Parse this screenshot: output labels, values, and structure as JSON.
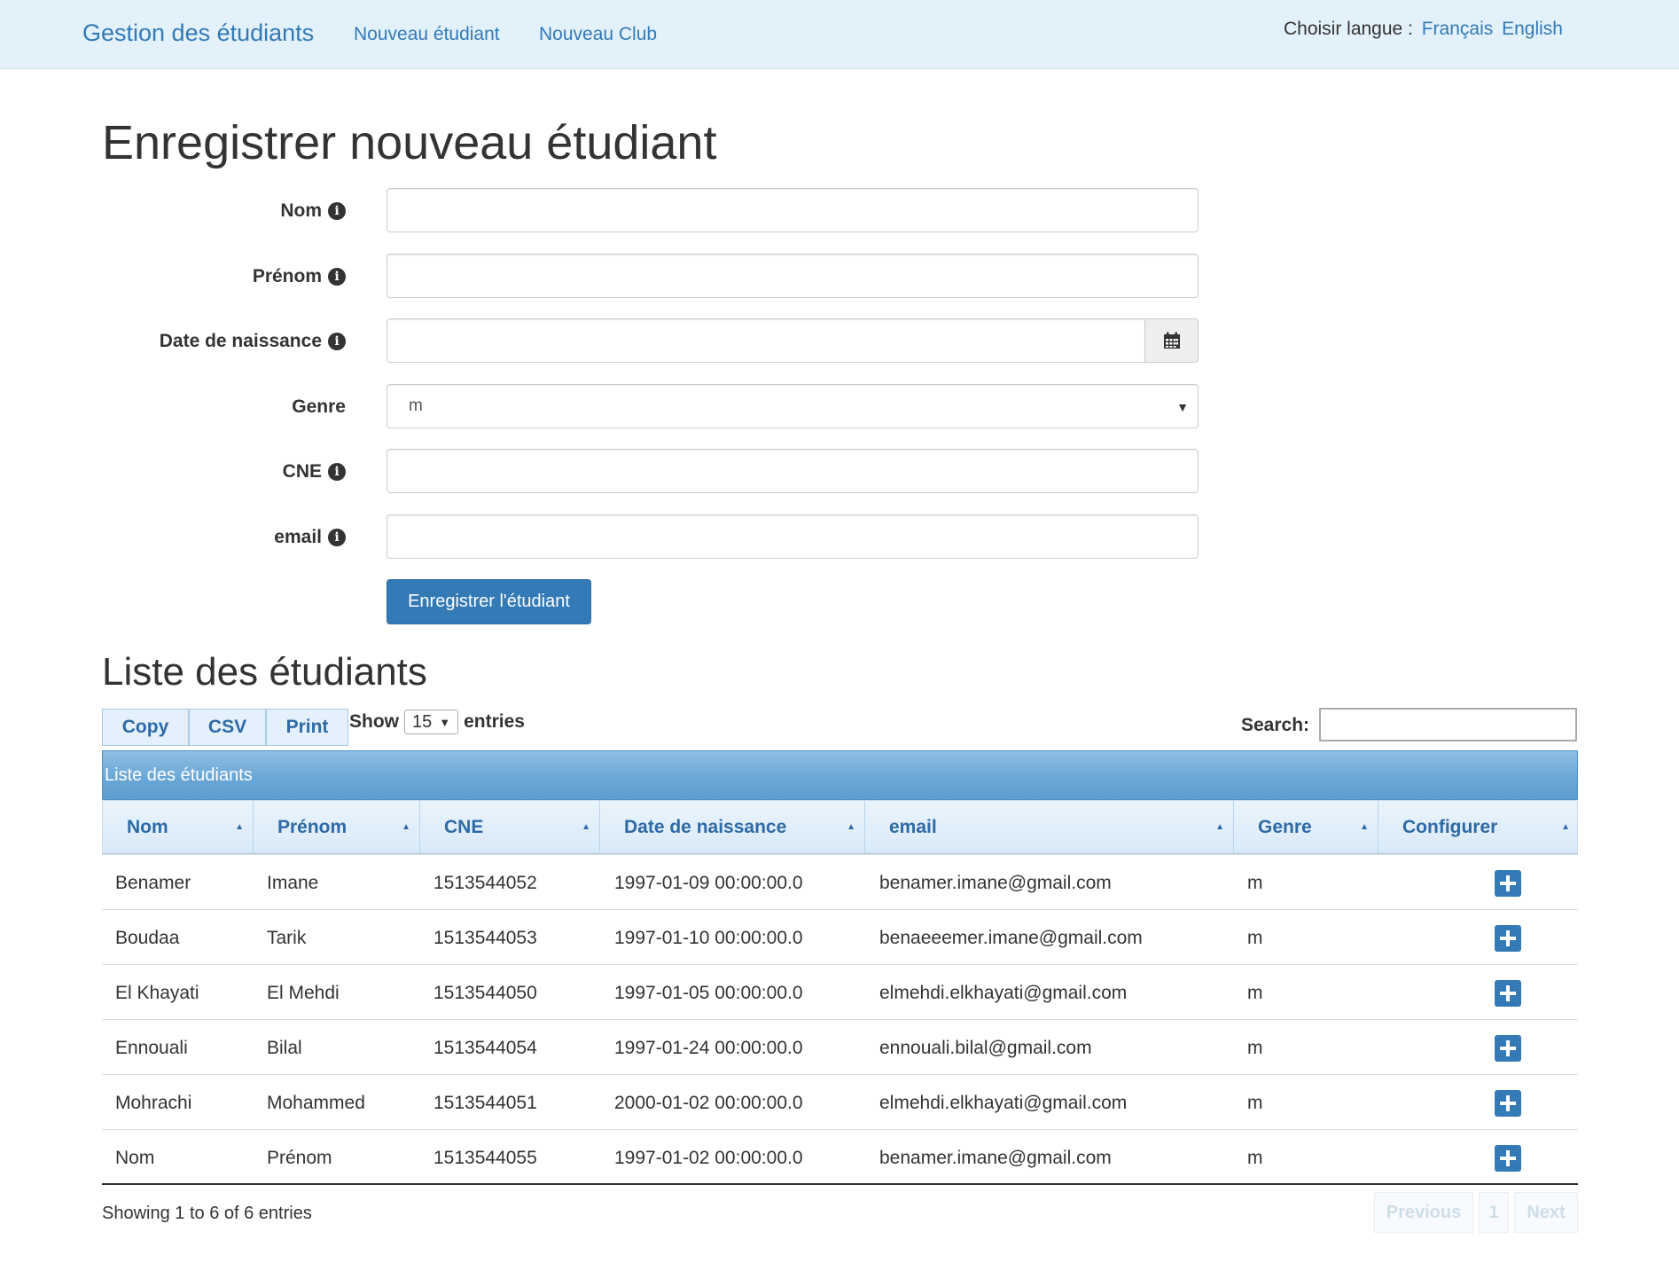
{
  "navbar": {
    "brand": "Gestion des étudiants",
    "links": [
      "Nouveau étudiant",
      "Nouveau Club"
    ],
    "lang_label": "Choisir langue :",
    "lang_fr": "Français",
    "lang_en": "English"
  },
  "form": {
    "title": "Enregistrer nouveau étudiant",
    "labels": {
      "nom": "Nom",
      "prenom": "Prénom",
      "date": "Date de naissance",
      "genre": "Genre",
      "cne": "CNE",
      "email": "email"
    },
    "values": {
      "nom": "",
      "prenom": "",
      "date": "",
      "cne": "",
      "email": ""
    },
    "genre_value": "m",
    "submit": "Enregistrer l'étudiant",
    "icons": {
      "info": "info-circle-icon",
      "calendar": "calendar-icon",
      "caret": "caret-down-icon"
    }
  },
  "list": {
    "title": "Liste des étudiants",
    "buttons": {
      "copy": "Copy",
      "csv": "CSV",
      "print": "Print"
    },
    "show_label": "Show",
    "entries_label": "entries",
    "page_length": "15",
    "search_label": "Search:",
    "search_value": "",
    "caption": "Liste des étudiants",
    "columns": [
      "Nom",
      "Prénom",
      "CNE",
      "Date de naissance",
      "email",
      "Genre",
      "Configurer"
    ],
    "rows": [
      [
        "Benamer",
        "Imane",
        "1513544052",
        "1997-01-09 00:00:00.0",
        "benamer.imane@gmail.com",
        "m"
      ],
      [
        "Boudaa",
        "Tarik",
        "1513544053",
        "1997-01-10 00:00:00.0",
        "benaeeemer.imane@gmail.com",
        "m"
      ],
      [
        "El Khayati",
        "El Mehdi",
        "1513544050",
        "1997-01-05 00:00:00.0",
        "elmehdi.elkhayati@gmail.com",
        "m"
      ],
      [
        "Ennouali",
        "Bilal",
        "1513544054",
        "1997-01-24 00:00:00.0",
        "ennouali.bilal@gmail.com",
        "m"
      ],
      [
        "Mohrachi",
        "Mohammed",
        "1513544051",
        "2000-01-02 00:00:00.0",
        "elmehdi.elkhayati@gmail.com",
        "m"
      ],
      [
        "Nom",
        "Prénom",
        "1513544055",
        "1997-01-02 00:00:00.0",
        "benamer.imane@gmail.com",
        "m"
      ]
    ],
    "info": "Showing 1 to 6 of 6 entries",
    "pagination": {
      "previous": "Previous",
      "page": "1",
      "next": "Next"
    }
  },
  "colors": {
    "accent": "#337ab7",
    "navbar_bg": "#e3f1fb",
    "caption_bg": "#6aa7d6"
  }
}
